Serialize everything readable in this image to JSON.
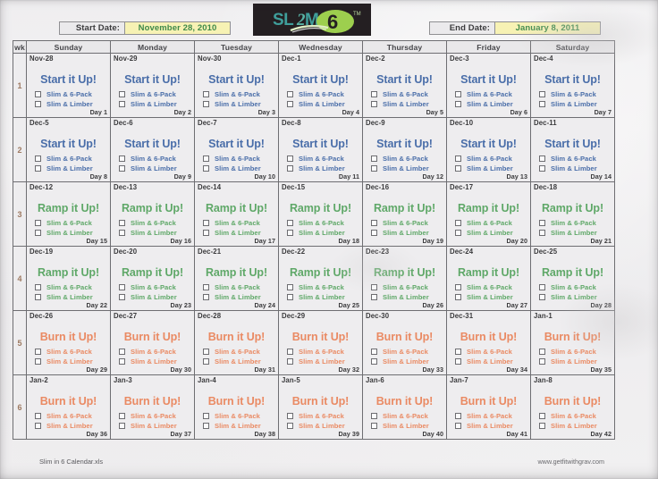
{
  "document": {
    "logo_text": "SLIM",
    "logo_numeral": "6",
    "footer_left": "Slim in 6 Calendar.xls",
    "footer_right": "www.getfitwithgrav.com"
  },
  "header": {
    "start_label": "Start Date:",
    "start_value": "November 28, 2010",
    "end_label": "End Date:",
    "end_value": "January 8, 2011"
  },
  "colors": {
    "start_phase": "#4a6ea9",
    "ramp_phase": "#5fa868",
    "burn_phase": "#ea8a63",
    "date_value_text": "#3f8a4a",
    "date_value_bg": "#f7f2b4",
    "week_number": "#9e7a62",
    "logo_bg": "#241f22",
    "logo_slim": "#3f9e9b",
    "logo_six": "#9dcf4e"
  },
  "columns": [
    "wk",
    "Sunday",
    "Monday",
    "Tuesday",
    "Wednesday",
    "Thursday",
    "Friday",
    "Saturday"
  ],
  "tasks": [
    "Slim & 6-Pack",
    "Slim & Limber"
  ],
  "phase_titles": {
    "start": "Start it Up!",
    "ramp": "Ramp it Up!",
    "burn": "Burn it Up!"
  },
  "weeks": [
    {
      "number": "1",
      "phase": "start",
      "title": "Start it Up!",
      "days": [
        {
          "date": "Nov-28",
          "day": "Day 1"
        },
        {
          "date": "Nov-29",
          "day": "Day 2"
        },
        {
          "date": "Nov-30",
          "day": "Day 3"
        },
        {
          "date": "Dec-1",
          "day": "Day 4"
        },
        {
          "date": "Dec-2",
          "day": "Day 5"
        },
        {
          "date": "Dec-3",
          "day": "Day 6"
        },
        {
          "date": "Dec-4",
          "day": "Day 7"
        }
      ]
    },
    {
      "number": "2",
      "phase": "start",
      "title": "Start it Up!",
      "days": [
        {
          "date": "Dec-5",
          "day": "Day 8"
        },
        {
          "date": "Dec-6",
          "day": "Day 9"
        },
        {
          "date": "Dec-7",
          "day": "Day 10"
        },
        {
          "date": "Dec-8",
          "day": "Day 11"
        },
        {
          "date": "Dec-9",
          "day": "Day 12"
        },
        {
          "date": "Dec-10",
          "day": "Day 13"
        },
        {
          "date": "Dec-11",
          "day": "Day 14"
        }
      ]
    },
    {
      "number": "3",
      "phase": "ramp",
      "title": "Ramp it Up!",
      "days": [
        {
          "date": "Dec-12",
          "day": "Day 15"
        },
        {
          "date": "Dec-13",
          "day": "Day 16"
        },
        {
          "date": "Dec-14",
          "day": "Day 17"
        },
        {
          "date": "Dec-15",
          "day": "Day 18"
        },
        {
          "date": "Dec-16",
          "day": "Day 19"
        },
        {
          "date": "Dec-17",
          "day": "Day 20"
        },
        {
          "date": "Dec-18",
          "day": "Day 21"
        }
      ]
    },
    {
      "number": "4",
      "phase": "ramp",
      "title": "Ramp it Up!",
      "days": [
        {
          "date": "Dec-19",
          "day": "Day 22"
        },
        {
          "date": "Dec-20",
          "day": "Day 23"
        },
        {
          "date": "Dec-21",
          "day": "Day 24"
        },
        {
          "date": "Dec-22",
          "day": "Day 25"
        },
        {
          "date": "Dec-23",
          "day": "Day 26"
        },
        {
          "date": "Dec-24",
          "day": "Day 27"
        },
        {
          "date": "Dec-25",
          "day": "Day 28"
        }
      ]
    },
    {
      "number": "5",
      "phase": "burn",
      "title": "Burn it Up!",
      "days": [
        {
          "date": "Dec-26",
          "day": "Day 29"
        },
        {
          "date": "Dec-27",
          "day": "Day 30"
        },
        {
          "date": "Dec-28",
          "day": "Day 31"
        },
        {
          "date": "Dec-29",
          "day": "Day 32"
        },
        {
          "date": "Dec-30",
          "day": "Day 33"
        },
        {
          "date": "Dec-31",
          "day": "Day 34"
        },
        {
          "date": "Jan-1",
          "day": "Day 35"
        }
      ]
    },
    {
      "number": "6",
      "phase": "burn",
      "title": "Burn it Up!",
      "days": [
        {
          "date": "Jan-2",
          "day": "Day 36"
        },
        {
          "date": "Jan-3",
          "day": "Day 37"
        },
        {
          "date": "Jan-4",
          "day": "Day 38"
        },
        {
          "date": "Jan-5",
          "day": "Day 39"
        },
        {
          "date": "Jan-6",
          "day": "Day 40"
        },
        {
          "date": "Jan-7",
          "day": "Day 41"
        },
        {
          "date": "Jan-8",
          "day": "Day 42"
        }
      ]
    }
  ]
}
